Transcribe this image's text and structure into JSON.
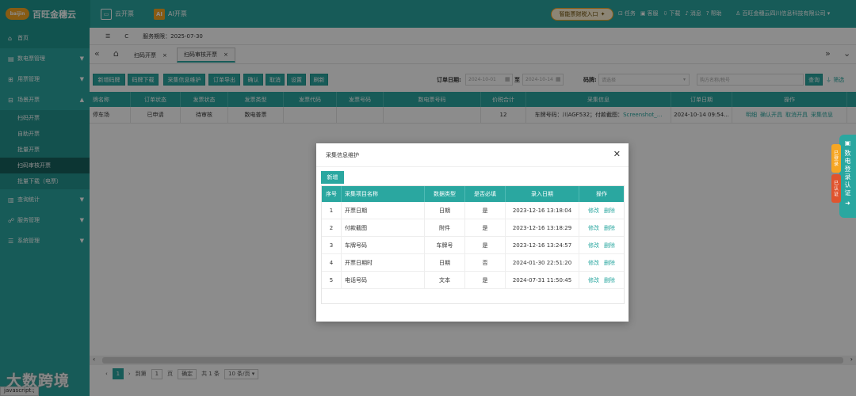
{
  "brand": {
    "logo_text": "baijin",
    "name": "百旺金穗云"
  },
  "topbar": {
    "tabs": [
      {
        "label": "云开票"
      },
      {
        "label": "AI开票"
      }
    ],
    "assistant": "智能票财税入口",
    "links": [
      "任务",
      "客服",
      "下载",
      "消息",
      "帮助"
    ],
    "user": "百旺金穗云四川信息科技有限公司"
  },
  "sidebar": {
    "items": [
      {
        "label": "首页",
        "icon": "home-icon"
      },
      {
        "label": "数电票管理",
        "icon": "invoice-icon"
      },
      {
        "label": "用票管理",
        "icon": "ticket-icon"
      },
      {
        "label": "场景开票",
        "icon": "scene-icon"
      },
      {
        "label": "查询统计",
        "icon": "chart-icon"
      },
      {
        "label": "服务管理",
        "icon": "service-icon"
      },
      {
        "label": "系统管理",
        "icon": "settings-icon"
      }
    ],
    "sub_items": [
      "扫码开票",
      "自助开票",
      "批量开票",
      "扫码审核开票",
      "批量下载（电票）"
    ]
  },
  "toolbar": {
    "menu_icon": "☰",
    "refresh_icon": "C",
    "service_period": "服务期限：2025-07-30"
  },
  "page_tabs": [
    "扫码开票",
    "扫码审核开票"
  ],
  "actions": {
    "buttons": [
      "新增码牌",
      "码牌下载",
      "采集信息维护",
      "订单导出",
      "确认",
      "取消",
      "设置",
      "刷新"
    ],
    "order_date_label": "订单日期:",
    "date_from": "2024-10-01",
    "date_sep": "至",
    "date_to": "2024-10-14",
    "code_label": "码牌:",
    "code_placeholder": "请选择",
    "buyer_placeholder": "购方名称/税号",
    "query": "查询",
    "filter": "筛选"
  },
  "grid": {
    "columns": [
      "牌名称",
      "订单状态",
      "发票状态",
      "发票类型",
      "发票代码",
      "发票号码",
      "数电票号码",
      "价税合计",
      "采集信息",
      "订单日期",
      "操作"
    ],
    "rows": [
      {
        "name": "停车场",
        "order_status": "已申请",
        "invoice_status": "待审核",
        "invoice_type": "数电普票",
        "invoice_code": "",
        "invoice_no": "",
        "digital_no": "",
        "total": "12",
        "collect_prefix": "车牌号码：川AGF532；付款截图：",
        "collect_link": "Screenshot_...",
        "order_date": "2024-10-14 09:54...",
        "ops": [
          "明细",
          "确认开具",
          "取消开具",
          "采集信息"
        ]
      }
    ]
  },
  "pager": {
    "page": "1",
    "goto_label": "到第",
    "goto_value": "1",
    "page_unit": "页",
    "confirm": "确定",
    "total": "共 1 条",
    "page_size": "10 条/页"
  },
  "watermark": "大数跨境",
  "status_text": "javascript:;",
  "modal": {
    "title": "采集信息维护",
    "add": "新增",
    "columns": [
      "序号",
      "采集项目名称",
      "数据类型",
      "是否必填",
      "录入日期",
      "操作"
    ],
    "rows": [
      {
        "no": "1",
        "name": "开票日期",
        "type": "日期",
        "required": "是",
        "date": "2023-12-16 13:18:04"
      },
      {
        "no": "2",
        "name": "付款截图",
        "type": "附件",
        "required": "是",
        "date": "2023-12-16 13:18:29"
      },
      {
        "no": "3",
        "name": "车牌号码",
        "type": "车牌号",
        "required": "是",
        "date": "2023-12-16 13:24:57"
      },
      {
        "no": "4",
        "name": "开票日期时",
        "type": "日期",
        "required": "否",
        "date": "2024-01-30 22:51:20"
      },
      {
        "no": "5",
        "name": "电话号码",
        "type": "文本",
        "required": "是",
        "date": "2024-07-31 11:50:45"
      }
    ],
    "edit": "修改",
    "delete": "删除"
  },
  "side": {
    "cert_tab": "数电登录认证",
    "badge_login": "已登录",
    "badge_cert": "已认证"
  }
}
